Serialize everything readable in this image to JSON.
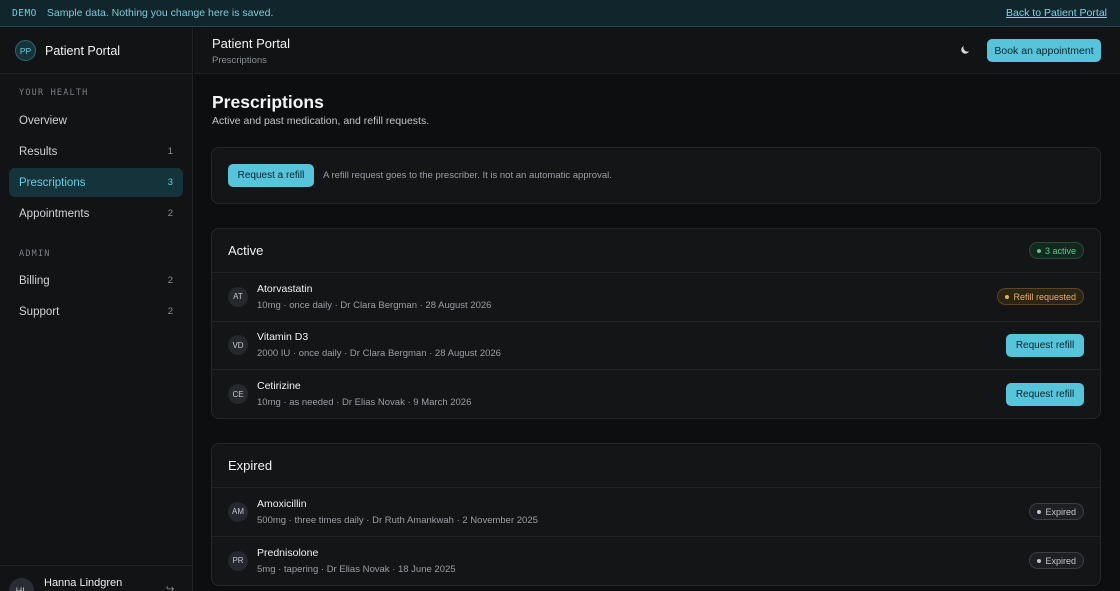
{
  "banner": {
    "tag": "DEMO",
    "message": "Sample data. Nothing you change here is saved.",
    "back_link": "Back to Patient Portal"
  },
  "brand": {
    "initials": "PP",
    "name": "Patient Portal"
  },
  "sidebar": {
    "sections": [
      {
        "label": "YOUR HEALTH"
      },
      {
        "label": "ADMIN"
      }
    ],
    "items": [
      {
        "label": "Overview",
        "count": ""
      },
      {
        "label": "Results",
        "count": "1"
      },
      {
        "label": "Prescriptions",
        "count": "3"
      },
      {
        "label": "Appointments",
        "count": "2"
      },
      {
        "label": "Billing",
        "count": "2"
      },
      {
        "label": "Support",
        "count": "2"
      }
    ]
  },
  "user": {
    "initials": "HL",
    "name": "Hanna Lindgren"
  },
  "topbar": {
    "title": "Patient Portal",
    "breadcrumb": "Prescriptions",
    "theme_icon": "moon-icon",
    "book_label": "Book an appointment"
  },
  "page": {
    "title": "Prescriptions",
    "subtitle": "Active and past medication, and refill requests."
  },
  "refill_panel": {
    "button_label": "Request a refill",
    "note": "A refill request goes to the prescriber. It is not an automatic approval."
  },
  "active": {
    "title": "Active",
    "badge": "3 active",
    "rows": [
      {
        "initials": "AT",
        "name": "Atorvastatin",
        "details": "10mg · once daily · Dr Clara Bergman · 28 August 2026",
        "status": "Refill requested"
      },
      {
        "initials": "VD",
        "name": "Vitamin D3",
        "details": "2000 IU · once daily · Dr Clara Bergman · 28 August 2026",
        "action": "Request refill"
      },
      {
        "initials": "CE",
        "name": "Cetirizine",
        "details": "10mg · as needed · Dr Elias Novak · 9 March 2026",
        "action": "Request refill"
      }
    ]
  },
  "expired": {
    "title": "Expired",
    "rows": [
      {
        "initials": "AM",
        "name": "Amoxicillin",
        "details": "500mg · three times daily · Dr Ruth Amankwah · 2 November 2025",
        "status": "Expired"
      },
      {
        "initials": "PR",
        "name": "Prednisolone",
        "details": "5mg · tapering · Dr Elias Novak · 18 June 2025",
        "status": "Expired"
      }
    ]
  },
  "colors": {
    "accent": "#56c4da",
    "success": "#58c98c",
    "warning": "#e2b35a",
    "background": "#0d0e10"
  }
}
